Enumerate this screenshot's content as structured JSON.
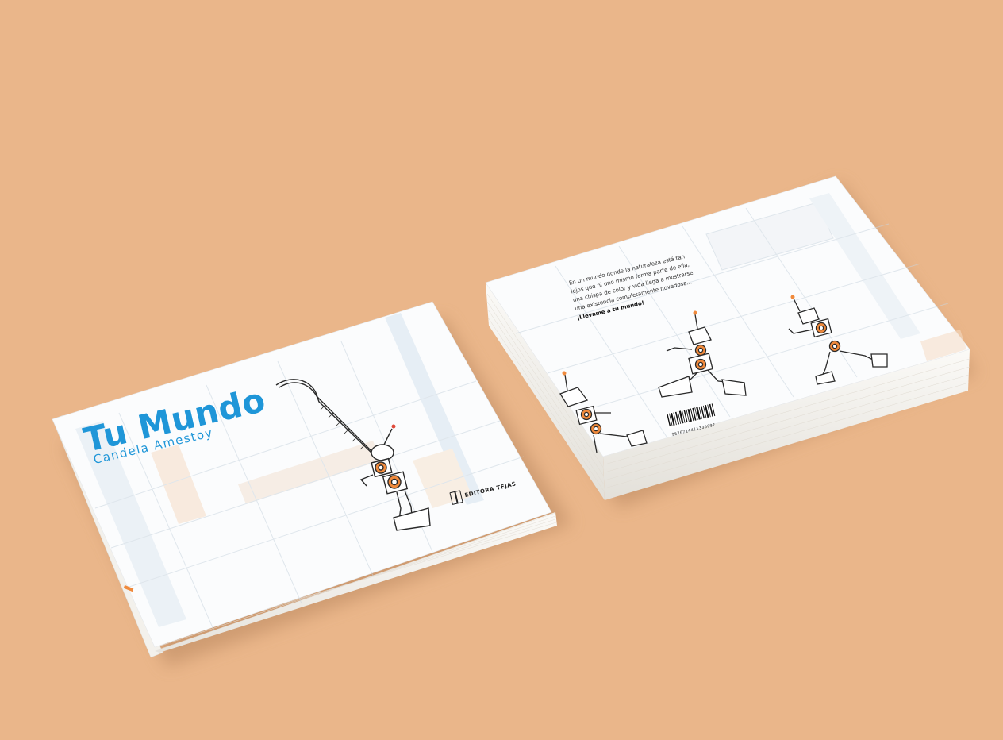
{
  "front_cover": {
    "title": "Tu Mundo",
    "author": "Candela Amestoy",
    "publisher": "EDITORA TEJAS"
  },
  "back_cover": {
    "blurb_lines": [
      "En un mundo donde la naturaleza está tan",
      "lejos que ni uno mismo forma parte de ella,",
      "una chispa de color y vida llega a mostrarse",
      "una existencia completamente novedosa..."
    ],
    "call_to_action": "¡Llevame a tu mundo!",
    "barcode_number": "9626714411336692"
  },
  "colors": {
    "background": "#eab68a",
    "title_blue": "#1f96d8",
    "robot_orange": "#f08a3c",
    "page_edge": "#f4f2ee"
  },
  "icons": [
    "book-logo-icon",
    "barcode-icon",
    "robot-illustration"
  ]
}
